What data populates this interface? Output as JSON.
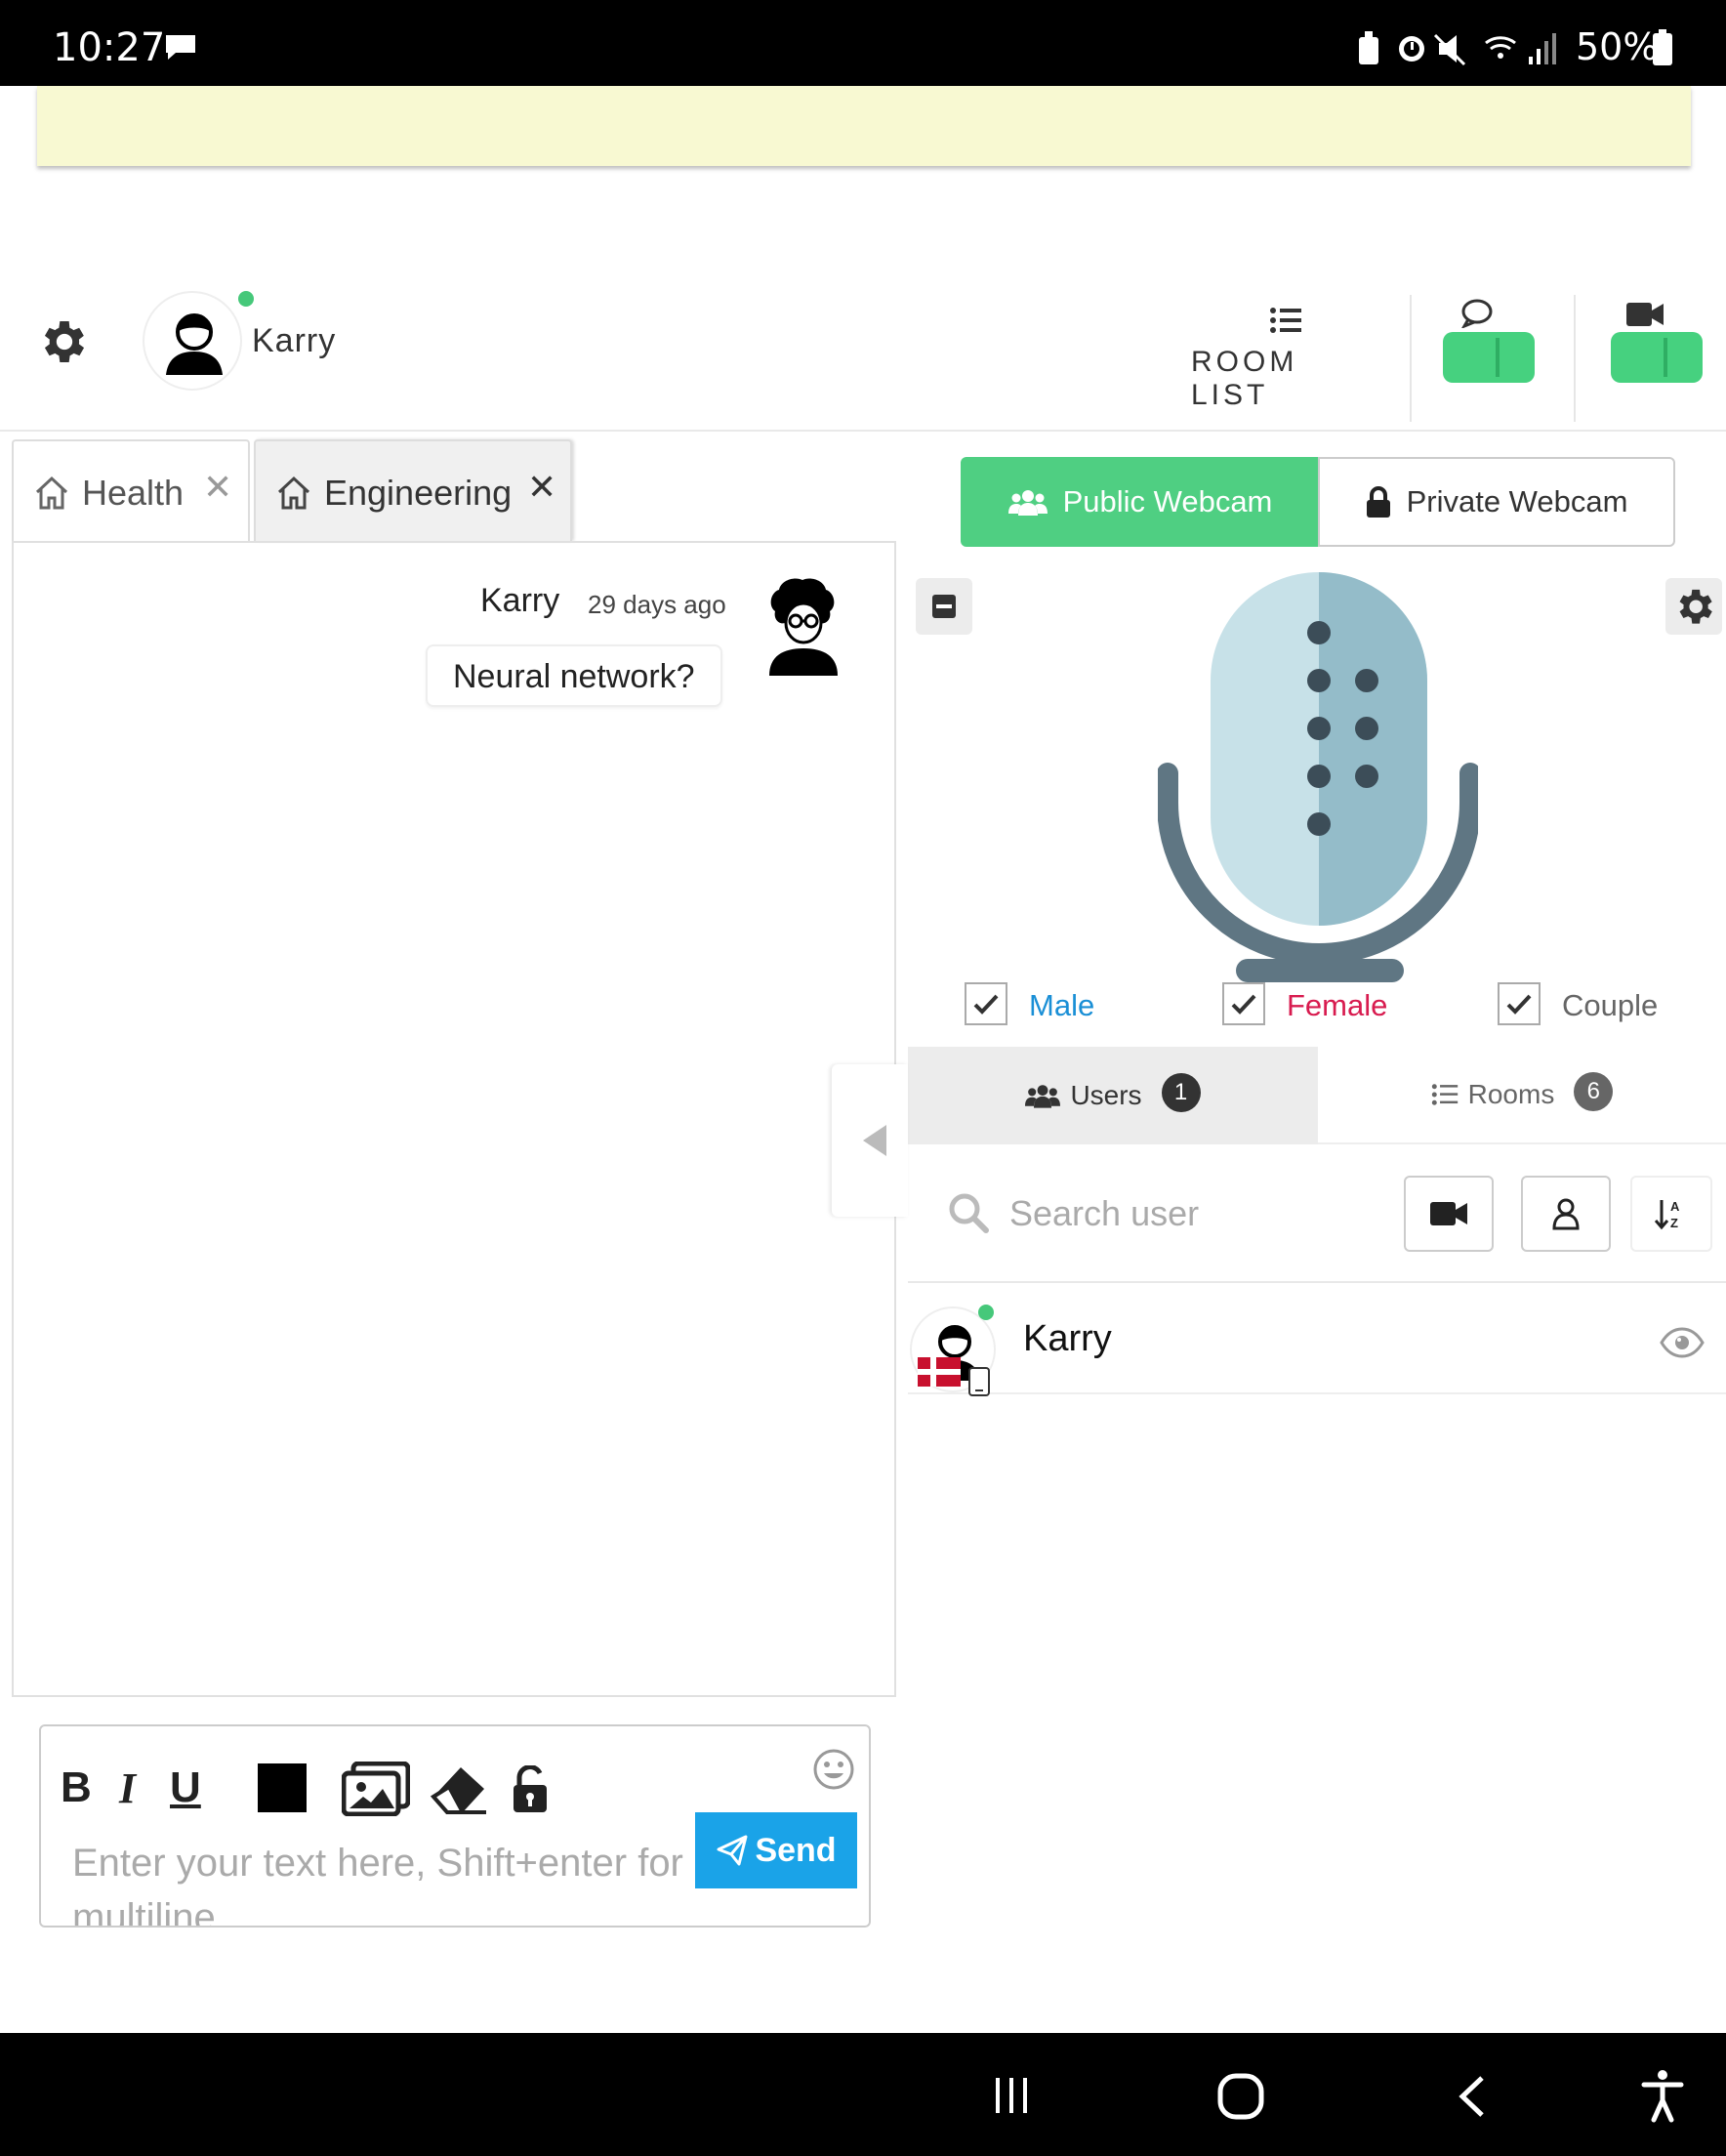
{
  "status_bar": {
    "time": "10:27",
    "battery": "50%",
    "icons": [
      "message-icon",
      "battery-saver-icon",
      "alarm-icon",
      "mute-icon",
      "wifi-icon",
      "signal-icon",
      "battery-icon"
    ]
  },
  "header": {
    "user_name": "Karry",
    "room_list_label": "ROOM LIST"
  },
  "tabs": [
    {
      "label": "Health"
    },
    {
      "label": "Engineering"
    }
  ],
  "chat": {
    "messages": [
      {
        "author": "Karry",
        "time": "29 days ago",
        "text": "Neural network?"
      }
    ]
  },
  "composer": {
    "placeholder": "Enter your text here, Shift+enter for multiline",
    "send_label": "Send"
  },
  "webcam": {
    "public_label": "Public Webcam",
    "private_label": "Private Webcam"
  },
  "filters": {
    "male": "Male",
    "female": "Female",
    "couple": "Couple",
    "male_color": "#1a8fd6",
    "female_color": "#d81b4f",
    "couple_color": "#666666"
  },
  "list_tabs": {
    "users_label": "Users",
    "users_count": "1",
    "rooms_label": "Rooms",
    "rooms_count": "6"
  },
  "search": {
    "placeholder": "Search user"
  },
  "users": [
    {
      "name": "Karry"
    }
  ],
  "colors": {
    "accent_green": "#4fcf82",
    "send_blue": "#1aa3e8",
    "banner": "#f8f9d2"
  }
}
